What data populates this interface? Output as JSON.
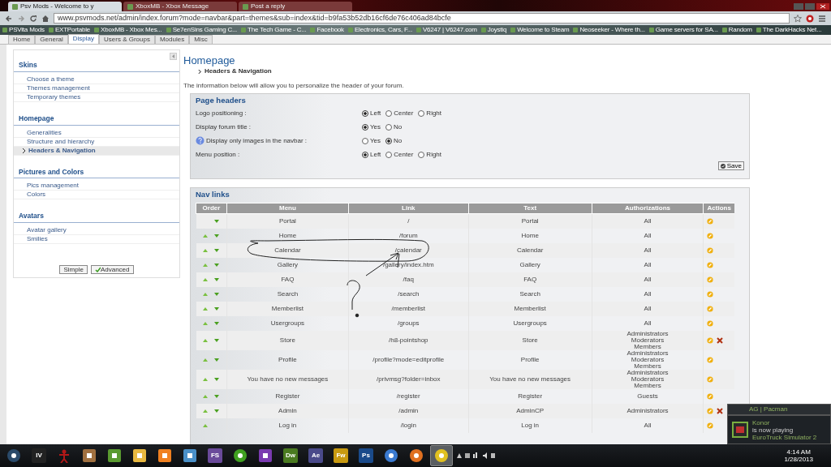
{
  "browser": {
    "tabs": [
      {
        "title": "Psv Mods - Welcome to y",
        "selected": true
      },
      {
        "title": "XboxMB - Xbox Message",
        "selected": false
      },
      {
        "title": "Post a reply",
        "selected": false
      }
    ],
    "address": "www.psvmods.net/admin/index.forum?mode=navbar&part=themes&sub=index&tid=b9fa53b52db16cf6de76c406ad84bcfe",
    "bookmarks": [
      "PSVita Mods",
      "EXTPortable",
      "XboxMB - Xbox Mes...",
      "Se7enSins Gaming C...",
      "The Tech Game - C...",
      "Facebook",
      "Electronics, Cars, F...",
      "V6247 | V6247.com",
      "Joystiq",
      "Welcome to Steam",
      "Neoseeker - Where th...",
      "Game servers for SA...",
      "Random",
      "The DarkHacks Net..."
    ]
  },
  "admin_tabs": [
    {
      "label": "Home",
      "selected": false
    },
    {
      "label": "General",
      "selected": false
    },
    {
      "label": "Display",
      "selected": true
    },
    {
      "label": "Users & Groups",
      "selected": false
    },
    {
      "label": "Modules",
      "selected": false
    },
    {
      "label": "Misc",
      "selected": false
    }
  ],
  "sidebar": {
    "groups": [
      {
        "title": "Skins",
        "items": [
          {
            "label": "Choose a theme",
            "selected": false
          },
          {
            "label": "Themes management",
            "selected": false
          },
          {
            "label": "Temporary themes",
            "selected": false
          }
        ]
      },
      {
        "title": "Homepage",
        "items": [
          {
            "label": "Generalities",
            "selected": false
          },
          {
            "label": "Structure and hierarchy",
            "selected": false
          },
          {
            "label": "Headers & Navigation",
            "selected": true
          }
        ]
      },
      {
        "title": "Pictures and Colors",
        "items": [
          {
            "label": "Pics management",
            "selected": false
          },
          {
            "label": "Colors",
            "selected": false
          }
        ]
      },
      {
        "title": "Avatars",
        "items": [
          {
            "label": "Avatar gallery",
            "selected": false
          },
          {
            "label": "Smilies",
            "selected": false
          }
        ]
      }
    ],
    "buttons": [
      {
        "label": "Simple",
        "kind": "plain"
      },
      {
        "label": "Advanced",
        "kind": "check"
      }
    ]
  },
  "main": {
    "title": "Homepage",
    "breadcrumb": "Headers & Navigation",
    "intro": "The information below will allow you to personalize the header of your forum.",
    "page_headers": {
      "title": "Page headers",
      "save": "Save",
      "fields": [
        {
          "label": "Logo positioning :",
          "help": false,
          "options": [
            {
              "label": "Left",
              "selected": true
            },
            {
              "label": "Center",
              "selected": false
            },
            {
              "label": "Right",
              "selected": false
            }
          ]
        },
        {
          "label": "Display forum title :",
          "help": false,
          "options": [
            {
              "label": "Yes",
              "selected": true
            },
            {
              "label": "No",
              "selected": false
            }
          ]
        },
        {
          "label": "Display only images in the navbar :",
          "help": true,
          "options": [
            {
              "label": "Yes",
              "selected": false
            },
            {
              "label": "No",
              "selected": true
            }
          ]
        },
        {
          "label": "Menu position :",
          "help": false,
          "options": [
            {
              "label": "Left",
              "selected": true
            },
            {
              "label": "Center",
              "selected": false
            },
            {
              "label": "Right",
              "selected": false
            }
          ]
        }
      ]
    },
    "nav_links": {
      "title": "Nav links",
      "columns": [
        "Order",
        "Menu",
        "Link",
        "Text",
        "Authorizations",
        "Actions"
      ],
      "rows": [
        {
          "up": false,
          "down": true,
          "menu": "Portal",
          "link": "/",
          "text": "Portal",
          "authorizations": [
            "All"
          ],
          "deletable": false
        },
        {
          "up": true,
          "down": true,
          "menu": "Home",
          "link": "/forum",
          "text": "Home",
          "authorizations": [
            "All"
          ],
          "deletable": false
        },
        {
          "up": true,
          "down": true,
          "menu": "Calendar",
          "link": "/calendar",
          "text": "Calendar",
          "authorizations": [
            "All"
          ],
          "deletable": false
        },
        {
          "up": true,
          "down": true,
          "menu": "Gallery",
          "link": "/gallery/index.htm",
          "text": "Gallery",
          "authorizations": [
            "All"
          ],
          "deletable": false
        },
        {
          "up": true,
          "down": true,
          "menu": "FAQ",
          "link": "/faq",
          "text": "FAQ",
          "authorizations": [
            "All"
          ],
          "deletable": false
        },
        {
          "up": true,
          "down": true,
          "menu": "Search",
          "link": "/search",
          "text": "Search",
          "authorizations": [
            "All"
          ],
          "deletable": false
        },
        {
          "up": true,
          "down": true,
          "menu": "Memberlist",
          "link": "/memberlist",
          "text": "Memberlist",
          "authorizations": [
            "All"
          ],
          "deletable": false
        },
        {
          "up": true,
          "down": true,
          "menu": "Usergroups",
          "link": "/groups",
          "text": "Usergroups",
          "authorizations": [
            "All"
          ],
          "deletable": false
        },
        {
          "up": true,
          "down": true,
          "menu": "Store",
          "link": "/h8-pointshop",
          "text": "Store",
          "authorizations": [
            "Administrators",
            "Moderators",
            "Members"
          ],
          "deletable": true
        },
        {
          "up": true,
          "down": true,
          "menu": "Profile",
          "link": "/profile?mode=editprofile",
          "text": "Profile",
          "authorizations": [
            "Administrators",
            "Moderators",
            "Members"
          ],
          "deletable": false
        },
        {
          "up": true,
          "down": true,
          "menu": "You have no new messages",
          "link": "/privmsg?folder=inbox",
          "text": "You have no new messages",
          "authorizations": [
            "Administrators",
            "Moderators",
            "Members"
          ],
          "deletable": false
        },
        {
          "up": true,
          "down": true,
          "menu": "Register",
          "link": "/register",
          "text": "Register",
          "authorizations": [
            "Guests"
          ],
          "deletable": false
        },
        {
          "up": true,
          "down": true,
          "menu": "Admin",
          "link": "/admin",
          "text": "AdminCP",
          "authorizations": [
            "Administrators"
          ],
          "deletable": true
        },
        {
          "up": true,
          "down": false,
          "menu": "Log in",
          "link": "/login",
          "text": "Log in",
          "authorizations": [
            "All"
          ],
          "deletable": false
        }
      ]
    }
  },
  "notification": {
    "previous": "AG | Pacman",
    "name": "Konor",
    "status": "is now playing",
    "game": "EuroTruck Simulator 2"
  },
  "taskbar": {
    "apps": [
      {
        "kind": "circle",
        "color": "#2a4a6a",
        "selected": false
      },
      {
        "kind": "tile",
        "label": "IV",
        "color": "#222222",
        "selected": false
      },
      {
        "kind": "figure",
        "color": "#b01818",
        "selected": false
      },
      {
        "kind": "square",
        "color": "#a07040",
        "selected": false
      },
      {
        "kind": "square",
        "color": "#5a9a30",
        "selected": false
      },
      {
        "kind": "square",
        "color": "#e8b840",
        "selected": false
      },
      {
        "kind": "square",
        "color": "#f08020",
        "selected": false
      },
      {
        "kind": "square",
        "color": "#4a90c8",
        "selected": false
      },
      {
        "kind": "tile",
        "label": "FS",
        "color": "#6a4a9a",
        "selected": false
      },
      {
        "kind": "circle",
        "color": "#40a020",
        "selected": false
      },
      {
        "kind": "square",
        "color": "#7a3ab0",
        "selected": false
      },
      {
        "kind": "tile",
        "label": "Dw",
        "color": "#4a7a20",
        "selected": false
      },
      {
        "kind": "tile",
        "label": "Ae",
        "color": "#4a4a8a",
        "selected": false
      },
      {
        "kind": "tile",
        "label": "Fw",
        "color": "#c89a10",
        "selected": false
      },
      {
        "kind": "tile",
        "label": "Ps",
        "color": "#1a4a8a",
        "selected": false
      },
      {
        "kind": "circle",
        "color": "#3a7ad0",
        "selected": false
      },
      {
        "kind": "circle",
        "color": "#e07020",
        "selected": false
      },
      {
        "kind": "circle",
        "color": "#e0c020",
        "selected": true
      }
    ],
    "time": "4:14 AM",
    "date": "1/28/2013"
  }
}
